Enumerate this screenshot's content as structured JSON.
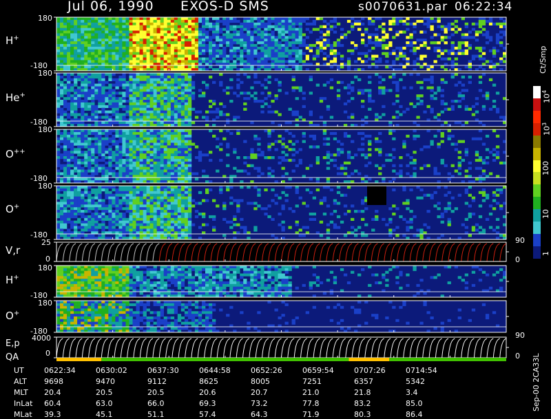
{
  "header": {
    "date": "Jul 06, 1990",
    "mission": "EXOS-D SMS",
    "file": "s0070631.par",
    "time": "06:22:34"
  },
  "panels": [
    {
      "label": "H",
      "sup": "+",
      "ymax": "180",
      "ymin": "-180"
    },
    {
      "label": "He",
      "sup": "+",
      "ymax": "180",
      "ymin": "-180"
    },
    {
      "label": "O",
      "sup": "++",
      "ymax": "180",
      "ymin": "-180"
    },
    {
      "label": "O",
      "sup": "+",
      "ymax": "180",
      "ymin": "-180"
    },
    {
      "label": "V,r",
      "sup": "",
      "ymax": "25",
      "ymin": "0",
      "rmax": "90",
      "rmin": "0"
    },
    {
      "label": "H",
      "sup": "+",
      "ymax": "180",
      "ymin": "-180"
    },
    {
      "label": "O",
      "sup": "+",
      "ymax": "180",
      "ymin": "-180"
    },
    {
      "label": "E,p",
      "sup": "",
      "ymax": "4000",
      "ymin": "0",
      "rmax": "90",
      "rmin": "0"
    }
  ],
  "qa_label": "QA",
  "colorbar": {
    "unit": "Ct/Smp",
    "labels": [
      "10",
      "100",
      "10",
      "1"
    ],
    "sup4": "4",
    "sup3": "3",
    "colors": [
      "#ffffff",
      "#c81010",
      "#ff2a00",
      "#d82000",
      "#8a7a00",
      "#c8b400",
      "#ffff30",
      "#c8e020",
      "#60d020",
      "#20b020",
      "#10a0a0",
      "#40c8d0",
      "#1a40c8",
      "#0c1a7a"
    ]
  },
  "footer": {
    "rows": [
      "UT",
      "ALT",
      "MLT",
      "InLat",
      "MLat"
    ],
    "columns": [
      {
        "UT": "0622:34",
        "ALT": "9698",
        "MLT": "20.4",
        "InLat": "60.4",
        "MLat": "39.3"
      },
      {
        "UT": "0630:02",
        "ALT": "9470",
        "MLT": "20.5",
        "InLat": "63.0",
        "MLat": "45.1"
      },
      {
        "UT": "0637:30",
        "ALT": "9112",
        "MLT": "20.5",
        "InLat": "66.0",
        "MLat": "51.1"
      },
      {
        "UT": "0644:58",
        "ALT": "8625",
        "MLT": "20.6",
        "InLat": "69.3",
        "MLat": "57.4"
      },
      {
        "UT": "0652:26",
        "ALT": "8005",
        "MLT": "20.7",
        "InLat": "73.2",
        "MLat": "64.3"
      },
      {
        "UT": "0659:54",
        "ALT": "7251",
        "MLT": "21.0",
        "InLat": "77.8",
        "MLat": "71.9"
      },
      {
        "UT": "0707:26",
        "ALT": "6357",
        "MLT": "21.8",
        "InLat": "83.2",
        "MLat": "80.3"
      },
      {
        "UT": "0714:54",
        "ALT": "5342",
        "MLT": "3.4",
        "InLat": "85.0",
        "MLat": "86.4"
      }
    ],
    "version": "Sep-00 2CA33L"
  },
  "chart_data": {
    "type": "heatmap",
    "title": "Jul 06, 1990 EXOS-D SMS",
    "x": [
      "0622:34",
      "0630:02",
      "0637:30",
      "0644:58",
      "0652:26",
      "0659:54",
      "0707:26",
      "0714:54"
    ],
    "panel_ranges": [
      [
        -180,
        180
      ],
      [
        -180,
        180
      ],
      [
        -180,
        180
      ],
      [
        -180,
        180
      ],
      [
        0,
        25
      ],
      [
        -180,
        180
      ],
      [
        -180,
        180
      ],
      [
        0,
        4000
      ]
    ],
    "colorbar_unit": "Ct/Smp",
    "colorbar_ticks": [
      1,
      10,
      100,
      1000,
      10000
    ]
  }
}
